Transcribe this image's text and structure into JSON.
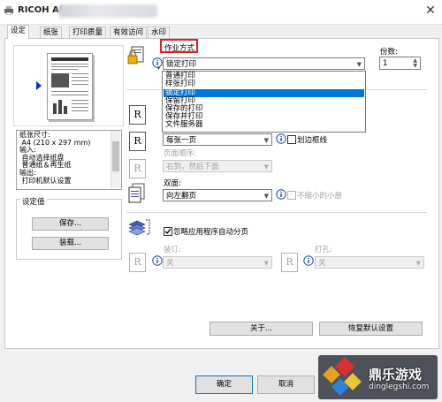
{
  "window": {
    "title": "RICOH Af",
    "close_glyph": "✕"
  },
  "tabs": [
    {
      "label": "设定"
    },
    {
      "label": "纸张"
    },
    {
      "label": "打印质量"
    },
    {
      "label": "有效访问"
    },
    {
      "label": "水印"
    }
  ],
  "preview": {
    "info_lines": "纸张尺寸:\n A4 (210 x 297 mm)\n输入:\n 自动选择纸盘\n 普通纸＆再生纸\n输出:\n 打印机默认设置"
  },
  "settings_group": {
    "title": "设定值",
    "save_label": "保存...",
    "load_label": "装载..."
  },
  "job_mode": {
    "label": "作业方式",
    "selected": "锁定打印",
    "options": [
      "普通打印",
      "样张打印",
      "锁定打印",
      "保留打印",
      "保存的打印",
      "保存并打印",
      "文件服务器"
    ],
    "highlighted_index": 2
  },
  "copies": {
    "label": "份数:",
    "value": "1"
  },
  "layout": {
    "pages_per_sheet": "每张一页",
    "border_label": "划边框线",
    "page_order_label": "页面顺序:",
    "page_order_value": "右到，然后下面"
  },
  "duplex": {
    "label": "双面:",
    "value": "向左翻页",
    "no_reduce_label": "不缩小的小册"
  },
  "collate": {
    "ignore_app_collate_label": "忽略应用程序自动分页",
    "ignore_app_collate_checked": true
  },
  "staple": {
    "label": "装订:",
    "value": "关"
  },
  "punch": {
    "label": "打孔:",
    "value": "关"
  },
  "buttons": {
    "about_label": "关于...",
    "restore_defaults_label": "恢复默认设置",
    "ok_label": "确定",
    "cancel_label": "取消"
  },
  "watermark": {
    "text": "鼎乐游戏",
    "sub": "dinglegshi.com"
  },
  "colors": {
    "highlight_blue": "#0078d7",
    "annotation_red": "#e02020"
  },
  "icons": {
    "job_mode": "lock-document-icon",
    "info": "info-icon",
    "layout": "page-r-icon",
    "duplex": "duplex-icon",
    "collate": "stack-icon"
  }
}
